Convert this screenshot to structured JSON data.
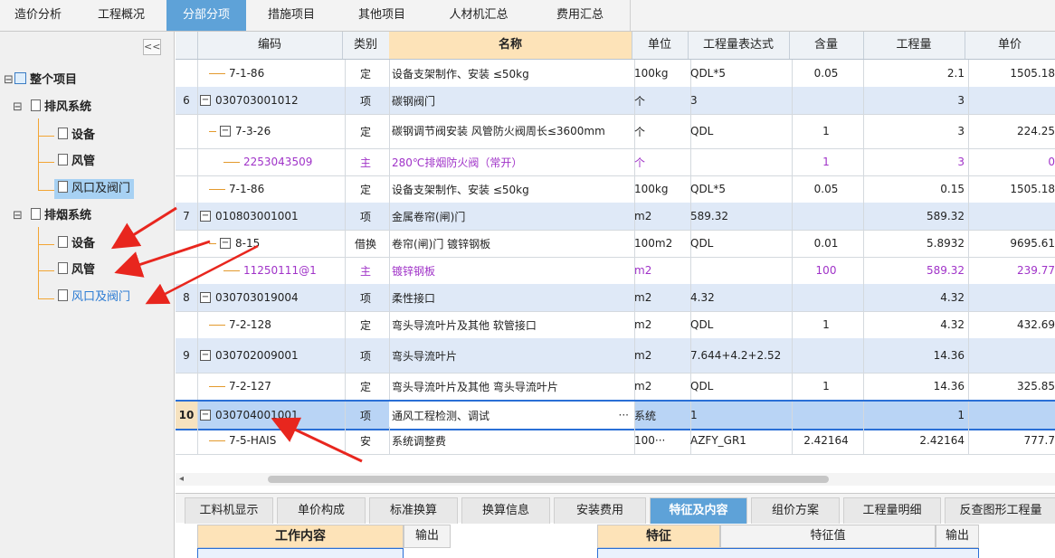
{
  "top_tabs": [
    "造价分析",
    "工程概况",
    "分部分项",
    "措施项目",
    "其他项目",
    "人材机汇总",
    "费用汇总"
  ],
  "top_tab_active": "分部分项",
  "left_panel": {
    "collapse_label": "<<",
    "tree": {
      "root": "整个项目",
      "groups": [
        {
          "name": "排风系统",
          "children": [
            "设备",
            "风管",
            "风口及阀门"
          ]
        },
        {
          "name": "排烟系统",
          "children": [
            "设备",
            "风管",
            "风口及阀门"
          ]
        }
      ]
    }
  },
  "grid": {
    "headers": [
      "编码",
      "类别",
      "名称",
      "单位",
      "工程量表达式",
      "含量",
      "工程量",
      "单价"
    ],
    "rows": [
      {
        "no": "",
        "code": "7-1-86",
        "type": "定",
        "name": "设备支架制作、安装 ≤50kg",
        "unit": "100kg",
        "expr": "QDL*5",
        "content": "0.05",
        "qty": "2.1",
        "price": "1505.18"
      },
      {
        "no": "6",
        "code": "030703001012",
        "type": "项",
        "name": "碳钢阀门",
        "unit": "个",
        "expr": "3",
        "content": "",
        "qty": "3",
        "price": ""
      },
      {
        "no": "",
        "code": "7-3-26",
        "type": "定",
        "name": "碳钢调节阀安装 风管防火阀周长≤3600mm",
        "unit": "个",
        "expr": "QDL",
        "content": "1",
        "qty": "3",
        "price": "224.25"
      },
      {
        "no": "",
        "code": "2253043509",
        "type": "主",
        "name": "280℃排烟防火阀（常开）",
        "unit": "个",
        "expr": "",
        "content": "1",
        "qty": "3",
        "price": "0"
      },
      {
        "no": "",
        "code": "7-1-86",
        "type": "定",
        "name": "设备支架制作、安装 ≤50kg",
        "unit": "100kg",
        "expr": "QDL*5",
        "content": "0.05",
        "qty": "0.15",
        "price": "1505.18"
      },
      {
        "no": "7",
        "code": "010803001001",
        "type": "项",
        "name": "金属卷帘(闸)门",
        "unit": "m2",
        "expr": "589.32",
        "content": "",
        "qty": "589.32",
        "price": ""
      },
      {
        "no": "",
        "code": "8-15",
        "type": "借换",
        "name": "卷帘(闸)门 镀锌钢板",
        "unit": "100m2",
        "expr": "QDL",
        "content": "0.01",
        "qty": "5.8932",
        "price": "9695.61"
      },
      {
        "no": "",
        "code": "11250111@1",
        "type": "主",
        "name": "镀锌钢板",
        "unit": "m2",
        "expr": "",
        "content": "100",
        "qty": "589.32",
        "price": "239.77"
      },
      {
        "no": "8",
        "code": "030703019004",
        "type": "项",
        "name": "柔性接口",
        "unit": "m2",
        "expr": "4.32",
        "content": "",
        "qty": "4.32",
        "price": ""
      },
      {
        "no": "",
        "code": "7-2-128",
        "type": "定",
        "name": "弯头导流叶片及其他 软管接口",
        "unit": "m2",
        "expr": "QDL",
        "content": "1",
        "qty": "4.32",
        "price": "432.69"
      },
      {
        "no": "9",
        "code": "030702009001",
        "type": "项",
        "name": "弯头导流叶片",
        "unit": "m2",
        "expr": "7.644+4.2+2.52",
        "content": "",
        "qty": "14.36",
        "price": ""
      },
      {
        "no": "",
        "code": "7-2-127",
        "type": "定",
        "name": "弯头导流叶片及其他 弯头导流叶片",
        "unit": "m2",
        "expr": "QDL",
        "content": "1",
        "qty": "14.36",
        "price": "325.85"
      },
      {
        "no": "10",
        "code": "030704001001",
        "type": "项",
        "name": "通风工程检测、调试",
        "unit": "系统",
        "expr": "1",
        "content": "",
        "qty": "1",
        "price": ""
      },
      {
        "no": "",
        "code": "7-5-HAIS",
        "type": "安",
        "name": "系统调整费",
        "unit": "100···",
        "expr": "AZFY_GR1",
        "content": "2.42164",
        "qty": "2.42164",
        "price": "777.7"
      }
    ],
    "ellipsis": "···"
  },
  "scroll_left_arrow": "◂",
  "bottom_tabs": [
    "工料机显示",
    "单价构成",
    "标准换算",
    "换算信息",
    "安装费用",
    "特征及内容",
    "组价方案",
    "工程量明细",
    "反查图形工程量"
  ],
  "bottom_tab_active": "特征及内容",
  "sub_panel": {
    "left_headers": [
      "工作内容",
      "输出"
    ],
    "right_headers": [
      "特征",
      "特征值",
      "输出"
    ]
  },
  "colors": {
    "active_tab": "#5ea2d8",
    "row_blue": "#dfe9f7",
    "row_selected": "#b9d4f5",
    "main_material": "#a033c8",
    "arrow": "#e8261e"
  }
}
